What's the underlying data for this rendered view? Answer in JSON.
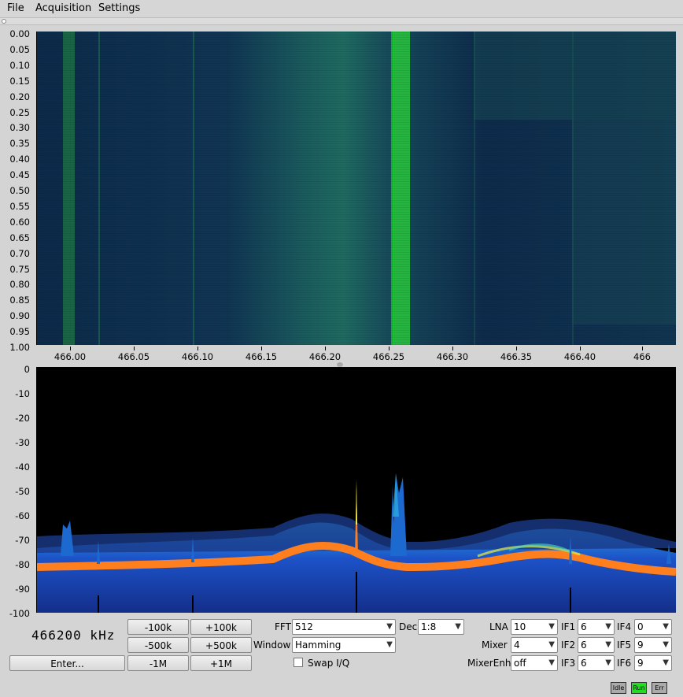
{
  "menu": {
    "file": "File",
    "acquisition": "Acquisition",
    "settings": "Settings"
  },
  "waterfall": {
    "y_labels": [
      "0.00",
      "0.05",
      "0.10",
      "0.15",
      "0.20",
      "0.25",
      "0.30",
      "0.35",
      "0.40",
      "0.45",
      "0.50",
      "0.55",
      "0.60",
      "0.65",
      "0.70",
      "0.75",
      "0.80",
      "0.85",
      "0.90",
      "0.95",
      "1.00"
    ],
    "x_labels": [
      "466.00",
      "466.05",
      "466.10",
      "466.15",
      "466.20",
      "466.25",
      "466.30",
      "466.35",
      "466.40",
      "466"
    ]
  },
  "spectrum": {
    "y_labels": [
      "0",
      "-10",
      "-20",
      "-30",
      "-40",
      "-50",
      "-60",
      "-70",
      "-80",
      "-90",
      "-100"
    ],
    "colors": {
      "background": "#000000",
      "floor": "#1a3fb0",
      "band": "#ff7f1e",
      "peak": "#e8f040"
    }
  },
  "frequency": {
    "display": "466200 kHz"
  },
  "buttons": {
    "minus100k": "-100k",
    "plus100k": "+100k",
    "minus500k": "-500k",
    "plus500k": "+500k",
    "minus1m": "-1M",
    "plus1m": "+1M",
    "enter": "Enter..."
  },
  "fft": {
    "label": "FFT",
    "value": "512"
  },
  "window": {
    "label": "Window",
    "value": "Hamming"
  },
  "dec": {
    "label": "Dec",
    "value": "1:8"
  },
  "swap_iq": {
    "label": "Swap I/Q",
    "checked": false
  },
  "gain": {
    "lna": {
      "label": "LNA",
      "value": "10"
    },
    "mixer": {
      "label": "Mixer",
      "value": "4"
    },
    "mixerenh": {
      "label": "MixerEnh",
      "value": "off"
    },
    "if1": {
      "label": "IF1",
      "value": "6"
    },
    "if2": {
      "label": "IF2",
      "value": "6"
    },
    "if3": {
      "label": "IF3",
      "value": "6"
    },
    "if4": {
      "label": "IF4",
      "value": "0"
    },
    "if5": {
      "label": "IF5",
      "value": "9"
    },
    "if6": {
      "label": "IF6",
      "value": "9"
    }
  },
  "status": {
    "idle": "Idle",
    "run": "Run",
    "err": "Err",
    "active": "run"
  }
}
